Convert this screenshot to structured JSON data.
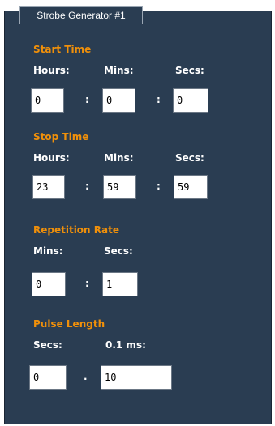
{
  "tab": {
    "label": "Strobe Generator #1"
  },
  "start_time": {
    "heading": "Start Time",
    "hours_label": "Hours:",
    "mins_label": "Mins:",
    "secs_label": "Secs:",
    "hours": "0",
    "mins": "0",
    "secs": "0",
    "sep": ":"
  },
  "stop_time": {
    "heading": "Stop Time",
    "hours_label": "Hours:",
    "mins_label": "Mins:",
    "secs_label": "Secs:",
    "hours": "23",
    "mins": "59",
    "secs": "59",
    "sep": ":"
  },
  "repetition_rate": {
    "heading": "Repetition Rate",
    "mins_label": "Mins:",
    "secs_label": "Secs:",
    "mins": "0",
    "secs": "1",
    "sep": ":"
  },
  "pulse_length": {
    "heading": "Pulse Length",
    "secs_label": "Secs:",
    "tenth_ms_label": "0.1 ms:",
    "secs": "0",
    "tenth_ms": "10",
    "sep": "."
  }
}
